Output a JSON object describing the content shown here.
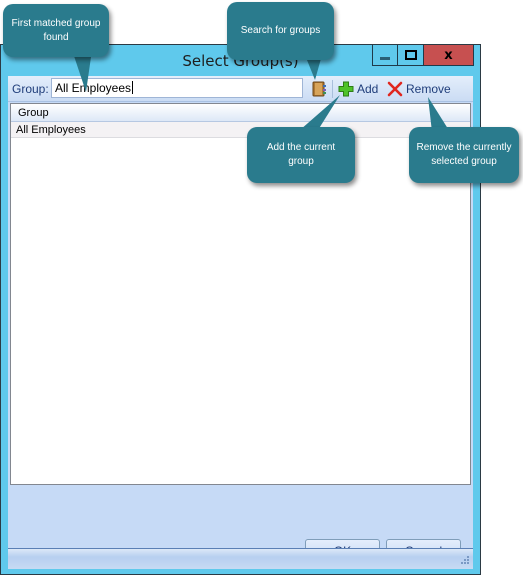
{
  "window": {
    "title": "Select Group(s)",
    "minimize_glyph": "–",
    "close_glyph": "x"
  },
  "toolbar": {
    "group_label": "Group:",
    "group_value": "All Employees",
    "search_icon": "address-book-icon",
    "add_label": "Add",
    "remove_label": "Remove"
  },
  "list": {
    "columns": [
      "Group"
    ],
    "rows": [
      {
        "group": "All Employees"
      }
    ]
  },
  "buttons": {
    "ok_label": "OK",
    "cancel_label": "Cancel"
  },
  "callouts": {
    "first_match": "First matched group found",
    "search": "Search for groups",
    "add": "Add the current group",
    "remove": "Remove the currently selected group"
  },
  "colors": {
    "window_frame": "#5fc9ec",
    "close_button": "#c75050",
    "callout_bg": "#2a7b8d",
    "client_bg": "#c6daf6"
  }
}
